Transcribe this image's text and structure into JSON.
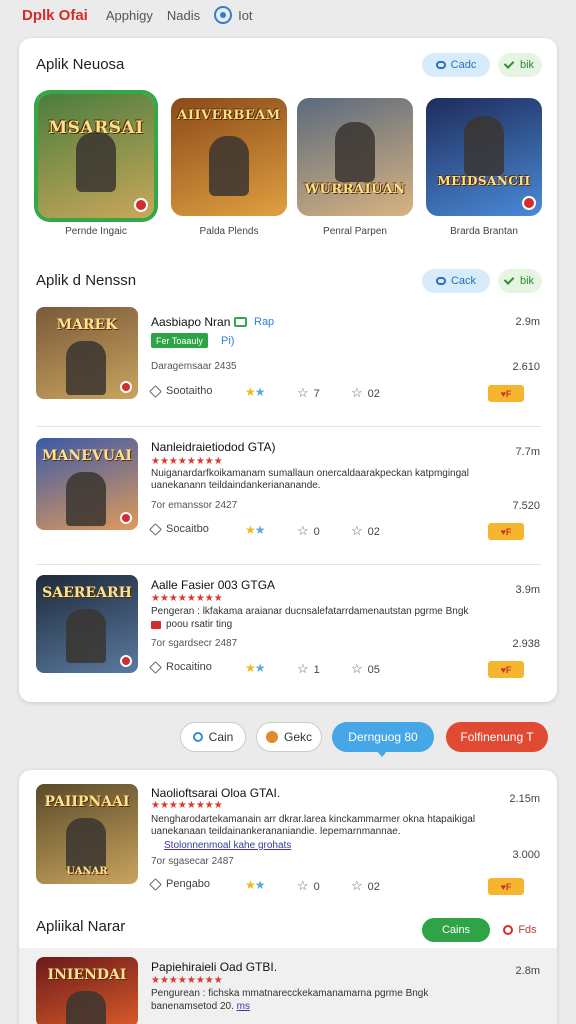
{
  "topbar": {
    "brand": "Dplk Ofai",
    "links": [
      "Apphigy",
      "Nadis"
    ],
    "icon_label": "Iot"
  },
  "featured": {
    "title": "Aplik Neuosa",
    "pill_blue": "Cadc",
    "pill_green": "bik",
    "tiles": [
      {
        "art": "MSARSAI",
        "caption": "Pernde Ingaic",
        "colors": [
          "#4a7d3e",
          "#c9a75a"
        ]
      },
      {
        "art": "AIIVERBEAM",
        "caption": "Palda Plends",
        "colors": [
          "#8a4a1a",
          "#e0a040"
        ]
      },
      {
        "art": "WURRAIUAN",
        "caption": "Penral Parpen",
        "colors": [
          "#5a6a7e",
          "#d9b380"
        ]
      },
      {
        "art": "MEIDSANCII",
        "caption": "Brarda Brantan",
        "colors": [
          "#1e2c5a",
          "#4a8ad8"
        ]
      }
    ]
  },
  "list": {
    "title": "Aplik d Nenssn",
    "pill_blue": "Cack",
    "pill_green": "bik",
    "rows": [
      {
        "art": "MAREK",
        "title": "Aasbiapo Nran",
        "tag_green": "Fer Toaauly",
        "tag_blue": "Rap",
        "tag_blue2": "Pi)",
        "size": "2.9m",
        "sub": "Daragemsaar 2435",
        "value": "2.610",
        "meta_tag": "Sootaitho",
        "meta_a": "7",
        "meta_b": "02",
        "badge": "F",
        "colors": [
          "#7a5a3a",
          "#c9a45e"
        ]
      },
      {
        "art": "MANEVUAI",
        "title": "Nanleidraietiodod GTA)",
        "size": "7.7m",
        "desc": "Nuiganardarfkoikamanam sumallaun onercaldaarakpeckan katpmgingal uanekanann teildaindankeriananande.",
        "sub": "7or emanssor 2427",
        "value": "7.520",
        "meta_tag": "Socaitbo",
        "meta_a": "0",
        "meta_b": "02",
        "badge": "F",
        "colors": [
          "#3a5aa8",
          "#e09a5a"
        ]
      },
      {
        "art": "SAEREARH",
        "title": "Aalle Fasier 003 GTGA",
        "size": "3.9m",
        "desc": "Pengeran : lkfakama araianar ducnsalefatarrdamenautstan pgrme Bngk",
        "desc2": "poou rsatir ting",
        "sub": "7or sgardsecr 2487",
        "value": "2.938",
        "meta_tag": "Rocaitino",
        "meta_a": "1",
        "meta_b": "05",
        "badge": "F",
        "colors": [
          "#1e2a3a",
          "#5a7aa0"
        ]
      }
    ]
  },
  "actions": [
    {
      "label": "Cain"
    },
    {
      "label": "Gekc"
    },
    {
      "label": "Dernguog 80"
    },
    {
      "label": "Folfinenung T"
    }
  ],
  "lower": {
    "row": {
      "art": "PAIIPNAAI",
      "art2": "UANAR",
      "title": "Naolioftsarai Oloa GTAI.",
      "size": "2.15m",
      "desc": "Nengharodartekamanain arr dkrar.larea kinckammarmer okna htapaikigal uanekanaan teildainankerananiandie. lepemarnmannae.",
      "link": "Stolonnenmoal kahe grohats",
      "sub": "7or sgasecar 2487",
      "value": "3.000",
      "meta_tag": "Pengabo",
      "meta_a": "0",
      "meta_b": "02",
      "badge": "F",
      "colors": [
        "#5a4a2a",
        "#c9a45e"
      ]
    },
    "section_title": "Apliikal Narar",
    "pill_green": "Cains",
    "pill_red": "Fds",
    "row2": {
      "art": "INIENDAI",
      "title": "Papiehiraieli Oad GTBI.",
      "size": "2.8m",
      "desc": "Pengurean : fichska mmatnarecckekamanamarna pgrme Bngk",
      "desc2": "banenamsetod 20.",
      "link": "ms",
      "colors": [
        "#6a1a1a",
        "#d85a2a"
      ]
    }
  }
}
